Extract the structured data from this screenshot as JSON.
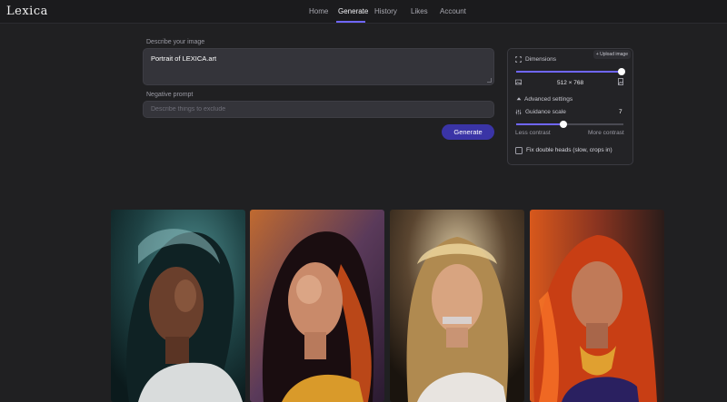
{
  "app": {
    "logo": "Lexica"
  },
  "nav": {
    "items": [
      {
        "label": "Home"
      },
      {
        "label": "Generate",
        "active": true
      },
      {
        "label": "History"
      },
      {
        "label": "Likes"
      },
      {
        "label": "Account"
      }
    ]
  },
  "prompt": {
    "label": "Describe your image",
    "value": "Portrait of LEXICA.art"
  },
  "negative": {
    "label": "Negative prompt",
    "placeholder": "Describe things to exclude"
  },
  "generate_label": "Generate",
  "settings": {
    "upload_label": "+ Upload image",
    "dimensions_label": "Dimensions",
    "dimensions_value": "512 × 768",
    "dimensions_slider": 1.0,
    "advanced_label": "Advanced settings",
    "guidance_label": "Guidance scale",
    "guidance_value": "7",
    "guidance_slider": 0.44,
    "less_contrast": "Less contrast",
    "more_contrast": "More contrast",
    "fix_heads_label": "Fix double heads (slow, crops in)",
    "fix_heads_checked": false
  },
  "colors": {
    "accent": "#6f66ff",
    "button": "#3a34a6",
    "background": "#202022"
  },
  "icons": {
    "dimensions": "crop-icon",
    "portrait": "image-icon",
    "landscape": "image-portrait-icon",
    "advanced": "chevron-up-icon",
    "guidance": "sliders-icon"
  }
}
